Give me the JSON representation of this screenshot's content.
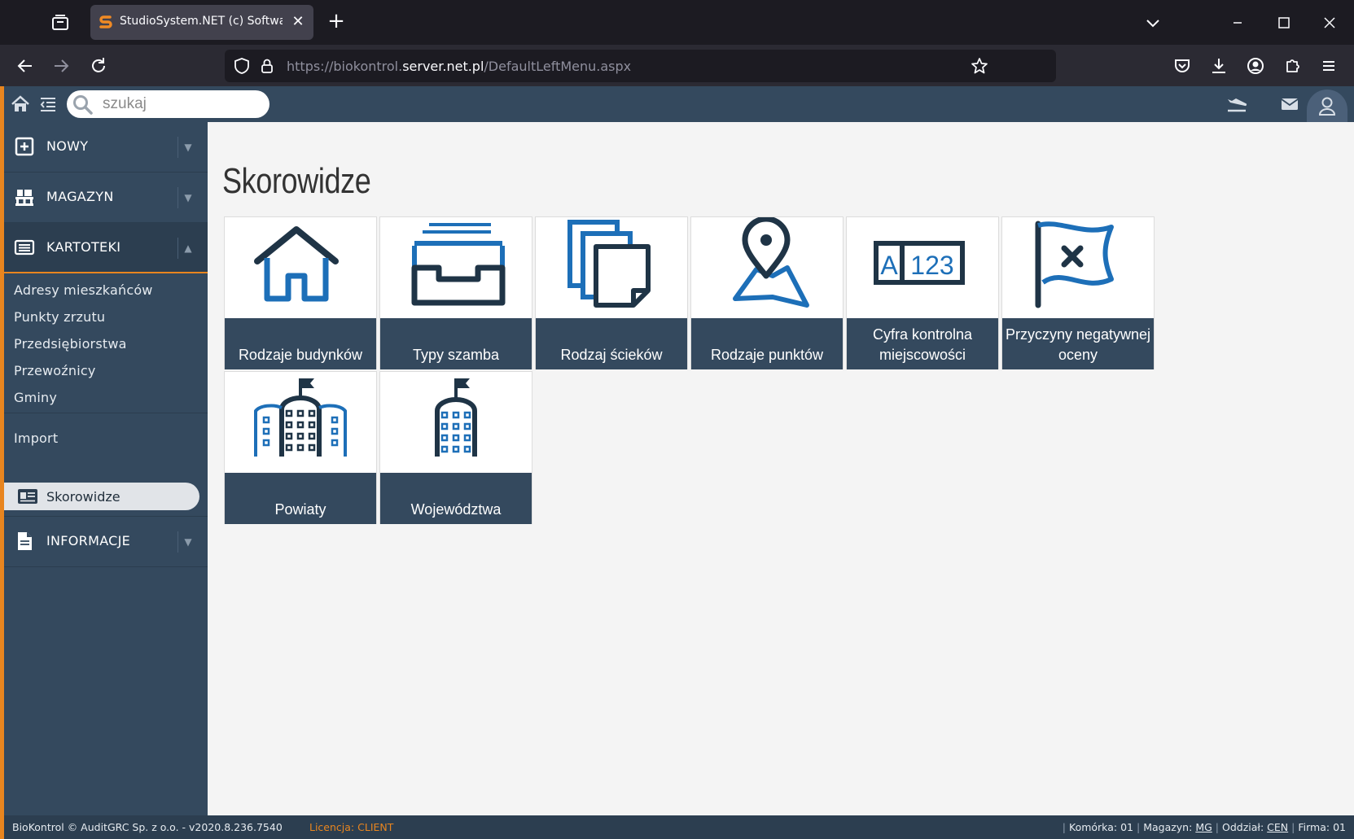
{
  "browser": {
    "tab_title": "StudioSystem.NET (c) SoftwareStudio",
    "url_prefix": "https://biokontrol.",
    "url_host": "server.net.pl",
    "url_path": "/DefaultLeftMenu.aspx"
  },
  "app": {
    "search_placeholder": "szukaj",
    "sidebar": {
      "nowy": "NOWY",
      "magazyn": "MAGAZYN",
      "kartoteki": "KARTOTEKI",
      "links": [
        "Adresy mieszkańców",
        "Punkty zrzutu",
        "Przedsiębiorstwa",
        "Przewoźnicy",
        "Gminy"
      ],
      "import": "Import",
      "active": "Skorowidze",
      "informacje": "INFORMACJE"
    },
    "page_title": "Skorowidze",
    "tiles": [
      {
        "label": "Rodzaje budynków",
        "icon": "house-icon"
      },
      {
        "label": "Typy szamba",
        "icon": "inbox-tray-icon"
      },
      {
        "label": "Rodzaj ścieków",
        "icon": "documents-icon"
      },
      {
        "label": "Rodzaje punktów",
        "icon": "map-pin-icon"
      },
      {
        "label": "Cyfra kontrolna miejscowości",
        "icon": "a123-icon"
      },
      {
        "label": "Przyczyny negatywnej oceny",
        "icon": "flag-x-icon"
      },
      {
        "label": "Powiaty",
        "icon": "building-large-icon"
      },
      {
        "label": "Województwa",
        "icon": "building-tower-icon"
      }
    ],
    "footer": {
      "left": "BioKontrol © AuditGRC Sp. z o.o. - v2020.8.236.7540",
      "license_label": "Licencja:",
      "license_value": "CLIENT",
      "komorka_label": "Komórka:",
      "komorka": "01",
      "magazyn_label": "Magazyn:",
      "magazyn": "MG",
      "oddzial_label": "Oddział:",
      "oddzial": "CEN",
      "firma_label": "Firma:",
      "firma": "01"
    },
    "colors": {
      "sidebar": "#34495e",
      "accent": "#e8851f",
      "icon_blue": "#1d6fb8",
      "icon_dark": "#1f3446"
    }
  }
}
